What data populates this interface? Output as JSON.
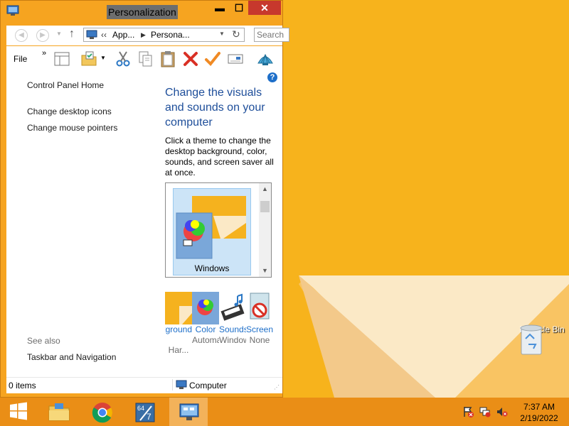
{
  "window": {
    "title": "Personalization",
    "minimize": "▬",
    "maximize": "☐",
    "close": "✕"
  },
  "address": {
    "overflow": "‹‹",
    "crumbs": [
      "App...",
      "Persona..."
    ],
    "search_placeholder": "Search"
  },
  "toolbar": {
    "file_label": "File",
    "more": "»",
    "icons": [
      "layout-icon",
      "properties-icon",
      "cut-icon",
      "copy-icon",
      "paste-icon",
      "delete-icon",
      "checkmark-icon",
      "rename-icon",
      "shell-icon"
    ]
  },
  "sidebar": {
    "links": [
      "Control Panel Home",
      "Change desktop icons",
      "Change mouse pointers"
    ],
    "see_also_label": "See also",
    "see_also_links": [
      "Taskbar and Navigation"
    ]
  },
  "main": {
    "heading": "Change the visuals and sounds on your computer",
    "description": "Click a theme to change the desktop background, color, sounds, and screen saver all at once.",
    "themes": [
      {
        "label": "Windows",
        "selected": true
      }
    ],
    "bottom_items": [
      {
        "link": "Desktop Background",
        "sub": "Har..."
      },
      {
        "link": "Color",
        "sub": "Automatic"
      },
      {
        "link": "Sounds",
        "sub": "Windows Default"
      },
      {
        "link": "Screen Saver",
        "sub": "None"
      }
    ],
    "help": "?"
  },
  "statusbar": {
    "items": "0 items",
    "zone": "Computer"
  },
  "desktop": {
    "recycle_bin": "Recycle Bin"
  },
  "taskbar": {
    "apps": [
      "start-icon",
      "file-explorer-icon",
      "chrome-icon",
      "app-64-icon",
      "control-panel-icon"
    ],
    "time": "7:37 AM",
    "date": "2/19/2022"
  },
  "colors": {
    "desktop": "#f7b31c",
    "window_frame": "#f6a420",
    "taskbar": "#ea8e16",
    "link": "#1e6fc9",
    "heading": "#1e4e9a",
    "close_button": "#c7382d"
  }
}
